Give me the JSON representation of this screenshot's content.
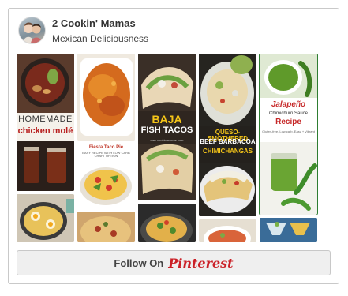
{
  "profile": {
    "name": "2 Cookin' Mamas",
    "tagline": "Mexican Deliciousness"
  },
  "pins": {
    "mole": {
      "line1": "HOMEMADE",
      "line2": "chicken molé"
    },
    "fiesta": {
      "title": "Fiesta Taco Pie",
      "subtitle": "EASY RECIPE WITH LOW CARB CRAFT OPTION"
    },
    "baja": {
      "line1": "BAJA",
      "line2": "FISH TACOS",
      "site": "mes.cookinmamas.com"
    },
    "chimi": {
      "line1": "QUESO-SMOTHERED",
      "line2": "BEEF BARBACOA",
      "line3": "CHIMICHANGAS"
    },
    "salsa": {
      "line1": "Jalapeño",
      "line2": "Chimichurri Sauce",
      "line3": "Recipe",
      "line4": "Gluten-free, Low carb, Easy + Vibrant"
    }
  },
  "footer": {
    "follow_label": "Follow On",
    "brand": "Pinterest"
  },
  "colors": {
    "brand_red": "#cb2027",
    "mole_red": "#b71c1c",
    "salsa_red": "#c62828",
    "baja_yellow": "#f5c518"
  }
}
